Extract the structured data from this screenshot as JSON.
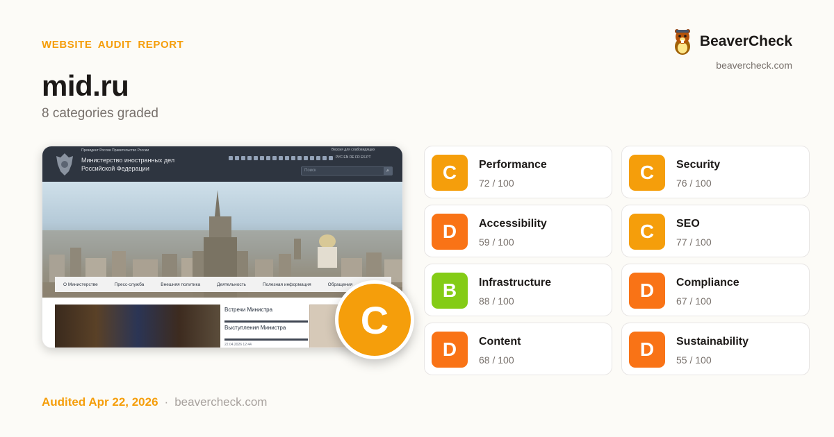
{
  "header": {
    "eyebrow": "WEBSITE AUDIT REPORT",
    "brand_name": "BeaverCheck",
    "brand_url": "beavercheck.com"
  },
  "site": {
    "title": "mid.ru",
    "subtitle": "8 categories graded"
  },
  "screenshot": {
    "top_links": "Президент России   Правительство России",
    "org_line1": "Министерство иностранных дел",
    "org_line2": "Российской Федерации",
    "eye_label": "Версия для слабовидящих",
    "langs": "РУС EN DE FR ES PT",
    "search_placeholder": "Поиск",
    "nav": [
      "О Министерстве",
      "Пресс-служба",
      "Внешняя политика",
      "Деятельность",
      "Полезная информация",
      "Обращения"
    ],
    "news": [
      "Встречи Министра",
      "Выступления Министра"
    ],
    "news_stamp": "22.04.2026 12:44"
  },
  "overall": {
    "grade": "C",
    "color": "#f59e0b"
  },
  "categories": [
    {
      "name": "Performance",
      "grade": "C",
      "score": "72 / 100",
      "color": "#f59e0b"
    },
    {
      "name": "Security",
      "grade": "C",
      "score": "76 / 100",
      "color": "#f59e0b"
    },
    {
      "name": "Accessibility",
      "grade": "D",
      "score": "59 / 100",
      "color": "#f97316"
    },
    {
      "name": "SEO",
      "grade": "C",
      "score": "77 / 100",
      "color": "#f59e0b"
    },
    {
      "name": "Infrastructure",
      "grade": "B",
      "score": "88 / 100",
      "color": "#84cc16"
    },
    {
      "name": "Compliance",
      "grade": "D",
      "score": "67 / 100",
      "color": "#f97316"
    },
    {
      "name": "Content",
      "grade": "D",
      "score": "68 / 100",
      "color": "#f97316"
    },
    {
      "name": "Sustainability",
      "grade": "D",
      "score": "55 / 100",
      "color": "#f97316"
    }
  ],
  "footer": {
    "audited": "Audited Apr 22, 2026",
    "separator": "·",
    "url": "beavercheck.com"
  }
}
